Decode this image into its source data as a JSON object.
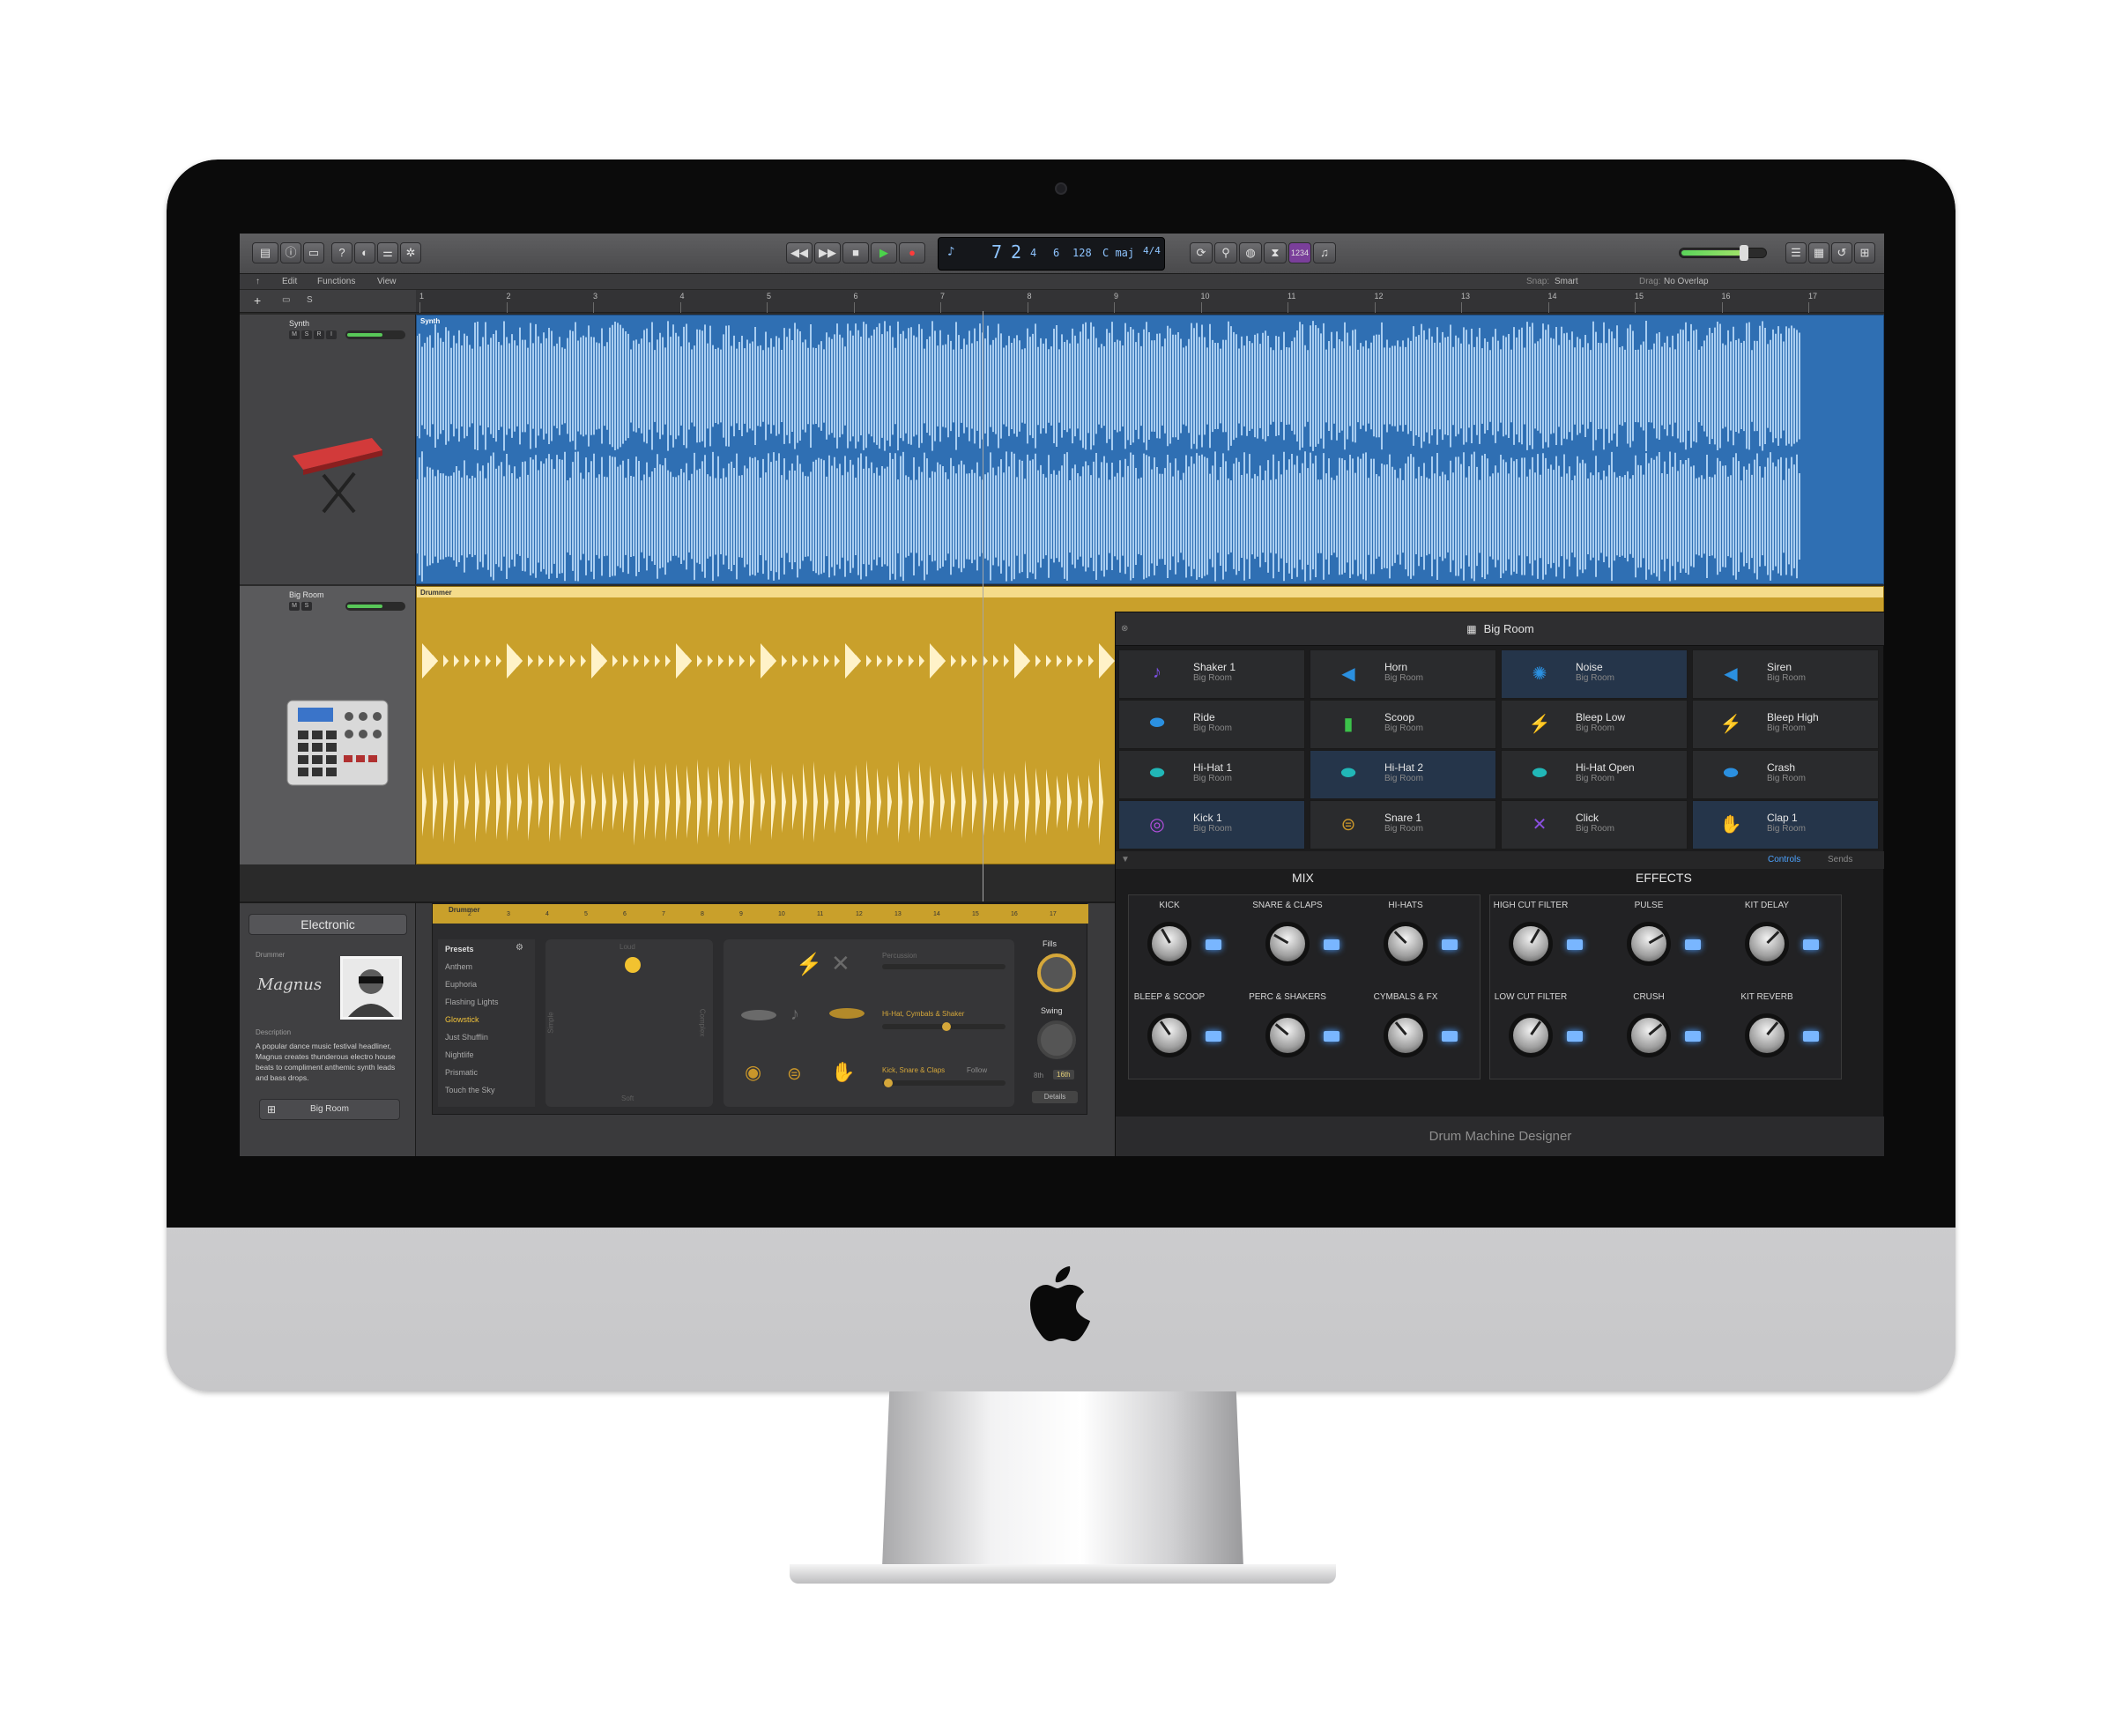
{
  "toolbar": {
    "lcd": {
      "bar": "7",
      "beat": "2",
      "div": "4",
      "tick": "6",
      "tempo": "128",
      "key": "C maj",
      "sig": "4/4"
    },
    "count_in": "1234"
  },
  "menus": [
    "Edit",
    "Functions",
    "View"
  ],
  "snap": {
    "label": "Snap:",
    "value": "Smart"
  },
  "drag": {
    "label": "Drag:",
    "value": "No Overlap"
  },
  "ruler": [
    "1",
    "2",
    "3",
    "4",
    "5",
    "6",
    "7",
    "8",
    "9",
    "10",
    "11",
    "12",
    "13",
    "14",
    "15",
    "16",
    "17"
  ],
  "tracks": [
    {
      "name": "Synth",
      "buttons": [
        "M",
        "S",
        "R",
        "I"
      ]
    },
    {
      "name": "Big Room",
      "buttons": [
        "M",
        "S"
      ]
    }
  ],
  "regions": {
    "synth": "Synth",
    "drummer": "Drummer"
  },
  "dmd": {
    "title": "Big Room",
    "pads": [
      {
        "name": "Shaker 1",
        "kit": "Big Room",
        "icon": "maraca-icon",
        "hl": false
      },
      {
        "name": "Horn",
        "kit": "Big Room",
        "icon": "horn-icon",
        "hl": false
      },
      {
        "name": "Noise",
        "kit": "Big Room",
        "icon": "noise-icon",
        "hl": true
      },
      {
        "name": "Siren",
        "kit": "Big Room",
        "icon": "siren-icon",
        "hl": false
      },
      {
        "name": "Ride",
        "kit": "Big Room",
        "icon": "ride-cymbal-icon",
        "hl": false
      },
      {
        "name": "Scoop",
        "kit": "Big Room",
        "icon": "scoop-icon",
        "hl": false
      },
      {
        "name": "Bleep Low",
        "kit": "Big Room",
        "icon": "bolt-icon",
        "hl": false
      },
      {
        "name": "Bleep High",
        "kit": "Big Room",
        "icon": "bolt-icon",
        "hl": false
      },
      {
        "name": "Hi-Hat 1",
        "kit": "Big Room",
        "icon": "hihat-icon",
        "hl": false
      },
      {
        "name": "Hi-Hat 2",
        "kit": "Big Room",
        "icon": "hihat-icon",
        "hl": true
      },
      {
        "name": "Hi-Hat Open",
        "kit": "Big Room",
        "icon": "hihat-open-icon",
        "hl": false
      },
      {
        "name": "Crash",
        "kit": "Big Room",
        "icon": "crash-cymbal-icon",
        "hl": false
      },
      {
        "name": "Kick 1",
        "kit": "Big Room",
        "icon": "kick-drum-icon",
        "hl": true
      },
      {
        "name": "Snare 1",
        "kit": "Big Room",
        "icon": "snare-drum-icon",
        "hl": false
      },
      {
        "name": "Click",
        "kit": "Big Room",
        "icon": "x-icon",
        "hl": false
      },
      {
        "name": "Clap 1",
        "kit": "Big Room",
        "icon": "clap-hand-icon",
        "hl": true
      }
    ],
    "tabs": {
      "controls": "Controls",
      "sends": "Sends"
    },
    "mix_label": "MIX",
    "effects_label": "EFFECTS",
    "mix_knobs": [
      "KICK",
      "SNARE & CLAPS",
      "HI-HATS",
      "BLEEP & SCOOP",
      "PERC & SHAKERS",
      "CYMBALS & FX"
    ],
    "fx_knobs": [
      "HIGH CUT FILTER",
      "PULSE",
      "KIT DELAY",
      "LOW CUT FILTER",
      "CRUSH",
      "KIT REVERB"
    ],
    "footer": "Drum Machine Designer"
  },
  "library": {
    "genre": "Electronic",
    "drummer_label": "Drummer",
    "signature": "Magnus",
    "description_label": "Description",
    "description": "A popular dance music festival headliner, Magnus creates thunderous electro house beats to compliment anthemic synth leads and bass drops.",
    "kit_button": "Big Room"
  },
  "drummer_editor": {
    "header": "Drummer",
    "presets_label": "Presets",
    "presets": [
      "Anthem",
      "Euphoria",
      "Flashing Lights",
      "Glowstick",
      "Just Shufflin",
      "Nightlife",
      "Prismatic",
      "Touch the Sky"
    ],
    "selected_preset": "Glowstick",
    "xy": {
      "top": "Loud",
      "bottom": "Soft",
      "left": "Simple",
      "right": "Complex"
    },
    "percussion": "Percussion",
    "hihat_row": "Hi-Hat, Cymbals & Shaker",
    "kick_row": "Kick, Snare & Claps",
    "follow": "Follow",
    "fills": "Fills",
    "swing": "Swing",
    "swing_options": [
      "8th",
      "16th"
    ],
    "details": "Details"
  }
}
